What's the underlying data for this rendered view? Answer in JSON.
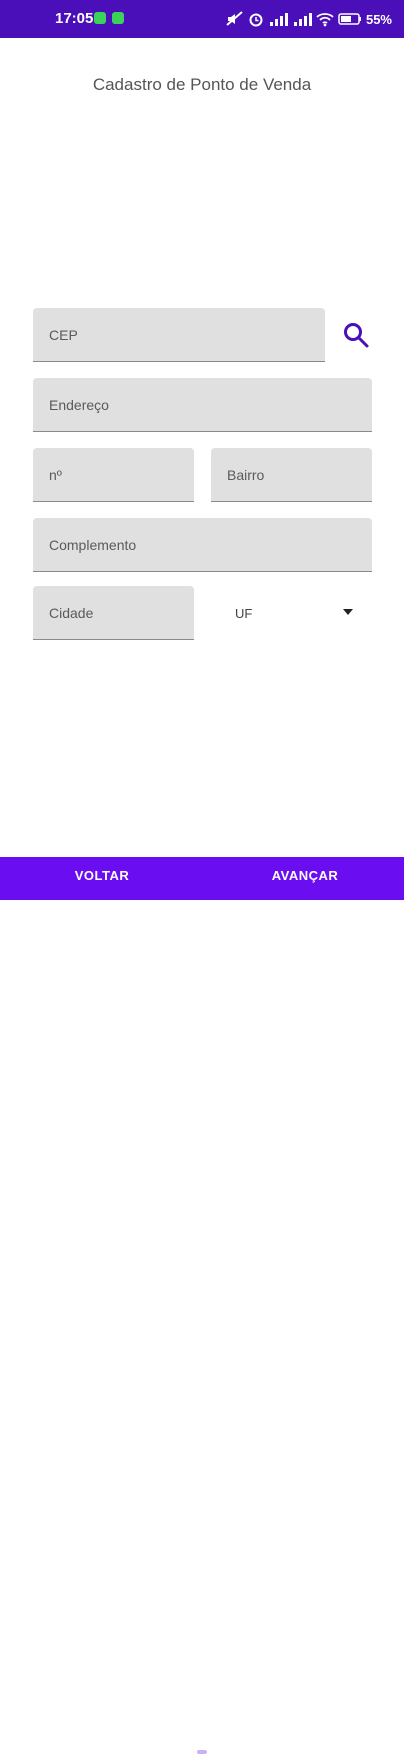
{
  "status_bar": {
    "time": "17:05",
    "battery": "55%",
    "colors": {
      "background": "#4a0fb8",
      "notification": "#3bd25a"
    },
    "icons": [
      "notification-icon",
      "notification-icon",
      "mute-icon",
      "alarm-icon",
      "signal-icon",
      "signal-icon",
      "wifi-icon",
      "battery-icon"
    ]
  },
  "page": {
    "title": "Cadastro de Ponto de Venda"
  },
  "form": {
    "cep": {
      "label": "CEP",
      "value": ""
    },
    "search_icon": "search-icon",
    "endereco": {
      "label": "Endereço",
      "value": ""
    },
    "numero": {
      "label": "nº",
      "value": ""
    },
    "bairro": {
      "label": "Bairro",
      "value": ""
    },
    "complemento": {
      "label": "Complemento",
      "value": ""
    },
    "cidade": {
      "label": "Cidade",
      "value": ""
    },
    "uf": {
      "label": "UF",
      "icon": "dropdown-arrow-icon"
    },
    "colors": {
      "field_background": "#e0e0e0",
      "accent": "#4a0fb8"
    }
  },
  "bottom_bar": {
    "back_label": "VOLTAR",
    "next_label": "AVANÇAR",
    "colors": {
      "background": "#6a0df0",
      "text": "#ffffff"
    }
  }
}
